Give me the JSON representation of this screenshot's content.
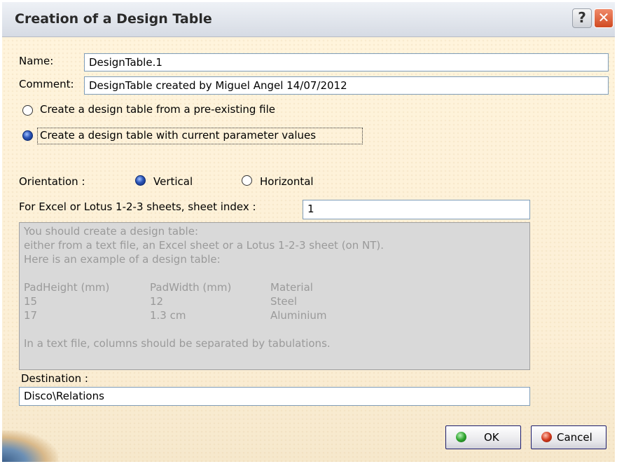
{
  "window": {
    "title": "Creation of a Design Table",
    "help_label": "?",
    "close_label": "✕"
  },
  "form": {
    "name_label": "Name:",
    "name_value": "DesignTable.1",
    "comment_label": "Comment:",
    "comment_value": "DesignTable created by Miguel Angel 14/07/2012",
    "source_options": [
      {
        "label": "Create a design table from a pre-existing file",
        "selected": false
      },
      {
        "label": "Create a design table with current parameter values",
        "selected": true
      }
    ],
    "orientation_label": "Orientation :",
    "orientation_options": [
      {
        "label": "Vertical",
        "selected": true
      },
      {
        "label": "Horizontal",
        "selected": false
      }
    ],
    "sheet_index_label": "For Excel or Lotus 1-2-3 sheets, sheet index :",
    "sheet_index_value": "1",
    "info_text": {
      "lines": [
        "You should create a design table:",
        "either from a text file, an Excel sheet or a Lotus 1-2-3 sheet (on NT).",
        "Here is an example of a design table:"
      ],
      "table_header": [
        "PadHeight (mm)",
        "PadWidth (mm)",
        "Material"
      ],
      "table_rows": [
        [
          "15",
          "12",
          "Steel"
        ],
        [
          "17",
          "1.3 cm",
          "Aluminium"
        ]
      ],
      "footer": "In a text file, columns should be separated by tabulations."
    },
    "destination_label": "Destination :",
    "destination_value": "Disco\\Relations"
  },
  "buttons": {
    "ok_label": "OK",
    "cancel_label": "Cancel"
  },
  "colors": {
    "dialog_bg": "#fbf1da",
    "radio_selected": "#2c56b8",
    "ok_dot": "#2fa52f",
    "cancel_dot": "#d23a1e"
  }
}
